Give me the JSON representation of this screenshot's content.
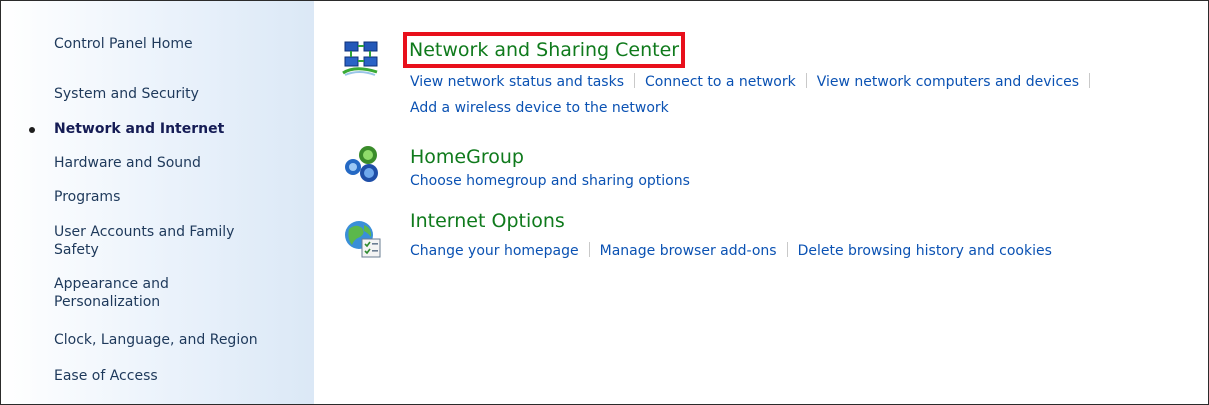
{
  "nav": {
    "items": [
      {
        "label": "Control Panel Home",
        "active": false
      },
      {
        "label": "System and Security",
        "active": false
      },
      {
        "label": "Network and Internet",
        "active": true
      },
      {
        "label": "Hardware and Sound",
        "active": false
      },
      {
        "label": "Programs",
        "active": false
      },
      {
        "label": "User Accounts and Family Safety",
        "active": false
      },
      {
        "label": "Appearance and Personalization",
        "active": false
      },
      {
        "label": "Clock, Language, and Region",
        "active": false
      },
      {
        "label": "Ease of Access",
        "active": false
      }
    ]
  },
  "categories": [
    {
      "title": "Network and Sharing Center",
      "icon": "network-sharing-icon",
      "highlighted": true,
      "tasks": [
        "View network status and tasks",
        "Connect to a network",
        "View network computers and devices",
        "Add a wireless device to the network"
      ]
    },
    {
      "title": "HomeGroup",
      "icon": "homegroup-icon",
      "tasks": [
        "Choose homegroup and sharing options"
      ]
    },
    {
      "title": "Internet Options",
      "icon": "internet-options-icon",
      "tasks": [
        "Change your homepage",
        "Manage browser add-ons",
        "Delete browsing history and cookies"
      ]
    }
  ],
  "colors": {
    "title_green": "#0f7a1c",
    "link_blue": "#0b52b3",
    "highlight_red": "#e8101b",
    "nav_text": "#1e395b"
  }
}
